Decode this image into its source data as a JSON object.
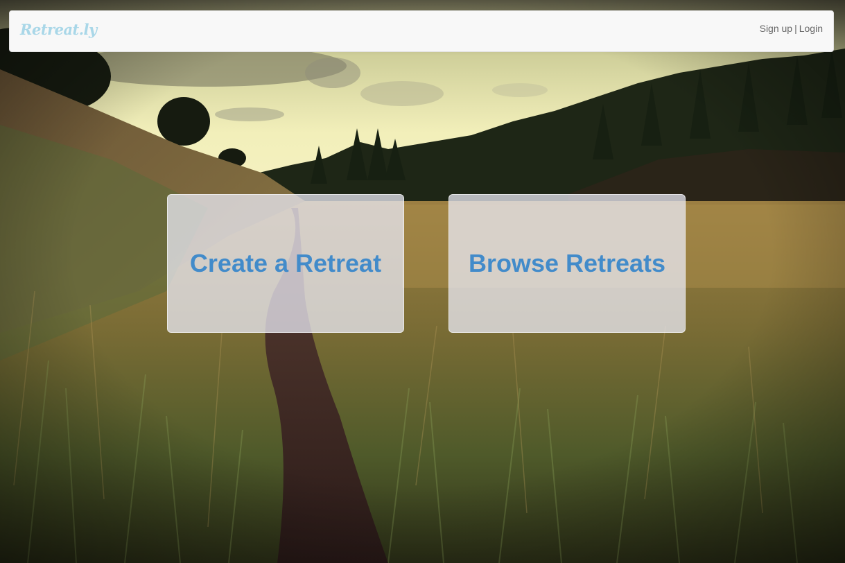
{
  "navbar": {
    "brand": "Retreat.ly",
    "signup_label": "Sign up",
    "separator": "|",
    "login_label": "Login"
  },
  "actions": {
    "create_label": "Create a Retreat",
    "browse_label": "Browse Retreats"
  },
  "colors": {
    "brand": "#a9d7e8",
    "action_text": "#428bca",
    "navbar_bg": "#f8f8f8"
  },
  "background": {
    "scene": "meadow-trail-photo"
  }
}
